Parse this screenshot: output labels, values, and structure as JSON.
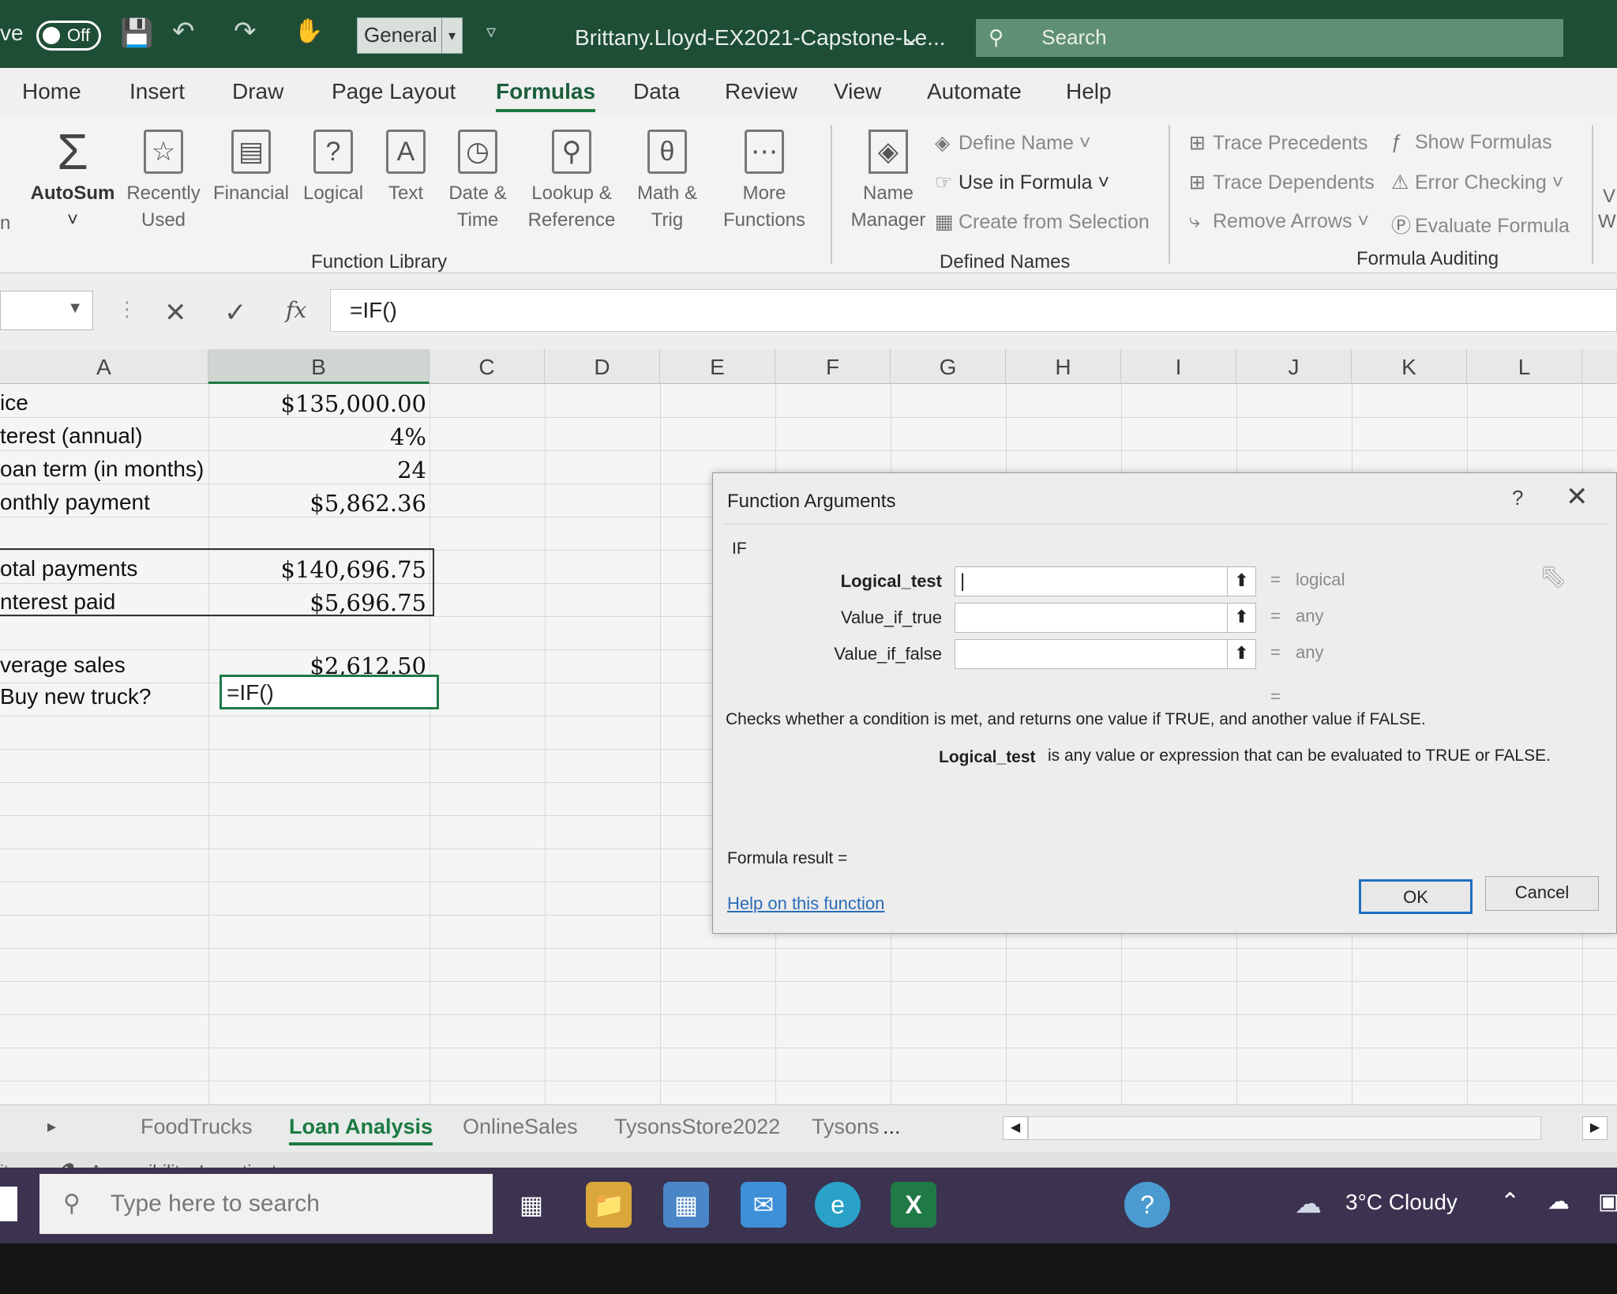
{
  "titlebar": {
    "autosave_label": "ve",
    "autosave_state": "Off",
    "number_format": "General",
    "filename": "Brittany.Lloyd-EX2021-Capstone-Le...",
    "search_label": "Search"
  },
  "ribbon_tabs": [
    "Home",
    "Insert",
    "Draw",
    "Page Layout",
    "Formulas",
    "Data",
    "Review",
    "View",
    "Automate",
    "Help"
  ],
  "active_tab": "Formulas",
  "function_library": {
    "group_label": "Function Library",
    "partial_left": "n",
    "autosum": "AutoSum",
    "recently_used_1": "Recently",
    "recently_used_2": "Used",
    "financial": "Financial",
    "logical": "Logical",
    "text": "Text",
    "date_time_1": "Date &",
    "date_time_2": "Time",
    "lookup_1": "Lookup &",
    "lookup_2": "Reference",
    "math_1": "Math &",
    "math_2": "Trig",
    "more_1": "More",
    "more_2": "Functions"
  },
  "defined_names": {
    "group_label": "Defined Names",
    "name_manager_1": "Name",
    "name_manager_2": "Manager",
    "define_name": "Define Name",
    "use_in_formula": "Use in Formula",
    "create_from_selection": "Create from Selection"
  },
  "formula_auditing": {
    "group_label": "Formula Auditing",
    "trace_precedents": "Trace Precedents",
    "trace_dependents": "Trace Dependents",
    "remove_arrows": "Remove Arrows",
    "show_formulas": "Show Formulas",
    "error_checking": "Error Checking",
    "evaluate_formula": "Evaluate Formula",
    "partial_1": "V",
    "partial_2": "W"
  },
  "formula_bar": {
    "content": "=IF()"
  },
  "columns": [
    "A",
    "B",
    "C",
    "D",
    "E",
    "F",
    "G",
    "H",
    "I",
    "J",
    "K",
    "L"
  ],
  "rows": [
    {
      "label": "ice",
      "value": "$135,000.00"
    },
    {
      "label": "terest (annual)",
      "value": "4%"
    },
    {
      "label": "oan term (in months)",
      "value": "24"
    },
    {
      "label": "onthly payment",
      "value": "$5,862.36"
    },
    {
      "label": "",
      "value": ""
    },
    {
      "label": "otal payments",
      "value": "$140,696.75"
    },
    {
      "label": "nterest paid",
      "value": "$5,696.75"
    },
    {
      "label": "",
      "value": ""
    },
    {
      "label": "verage sales",
      "value": "$2,612.50"
    },
    {
      "label": "Buy new truck?",
      "value": "=IF()"
    }
  ],
  "dialog": {
    "title": "Function Arguments",
    "help": "?",
    "function_name": "IF",
    "args": [
      {
        "name": "Logical_test",
        "result": "logical"
      },
      {
        "name": "Value_if_true",
        "result": "any"
      },
      {
        "name": "Value_if_false",
        "result": "any"
      }
    ],
    "equals": "=",
    "description": "Checks whether a condition is met, and returns one value if TRUE, and another value if FALSE.",
    "arg_help_name": "Logical_test",
    "arg_help_text": "is any value or expression that can be evaluated to TRUE or FALSE.",
    "formula_result": "Formula result =",
    "help_link": "Help on this function",
    "ok": "OK",
    "cancel": "Cancel"
  },
  "sheets": [
    "FoodTrucks",
    "Loan Analysis",
    "OnlineSales",
    "TysonsStore2022",
    "Tysons",
    "..."
  ],
  "active_sheet": "Loan Analysis",
  "status": {
    "partial": "it",
    "accessibility": "Accessibility: Investigate"
  },
  "taskbar": {
    "search_placeholder": "Type here to search",
    "weather": "3°C  Cloudy"
  },
  "colors": {
    "excel_green": "#1f7a45",
    "title_bar": "#1e4e36",
    "link_blue": "#2b6cb8"
  }
}
